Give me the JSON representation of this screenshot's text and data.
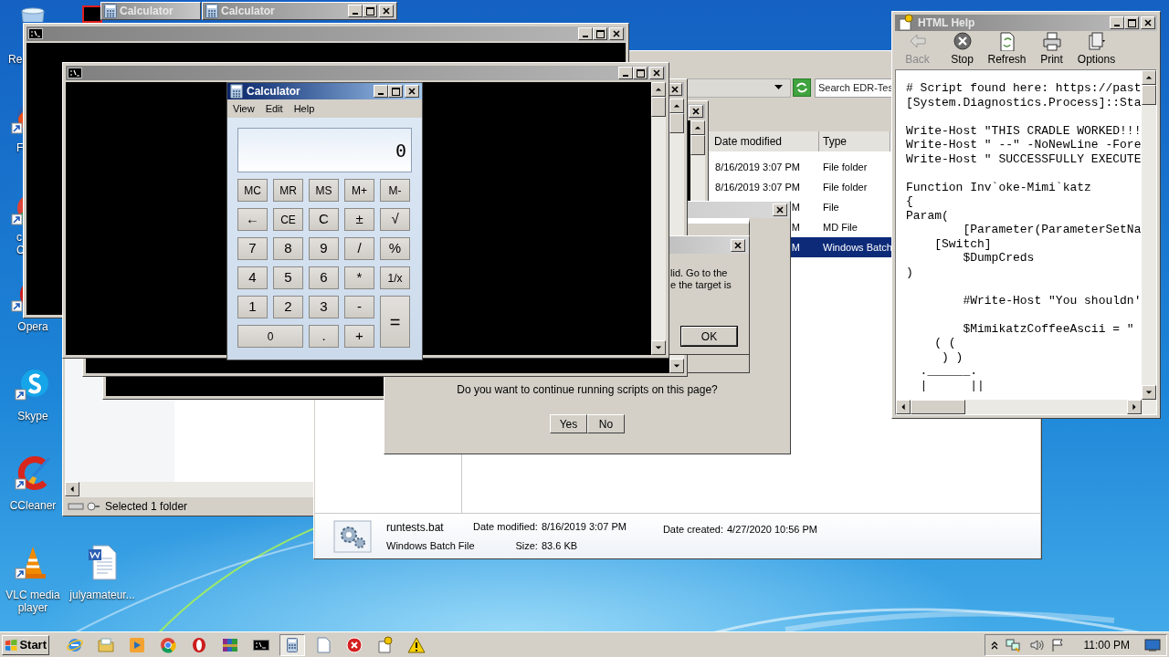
{
  "desktop_icons": [
    {
      "kind": "recycle",
      "label": "Re"
    },
    {
      "kind": "firefox",
      "label": "F"
    },
    {
      "kind": "chrome",
      "label": "c\nC"
    },
    {
      "kind": "opera",
      "label": "Opera"
    },
    {
      "kind": "skype",
      "label": "Skype"
    },
    {
      "kind": "ccleaner",
      "label": "CCleaner"
    },
    {
      "kind": "vlc",
      "label": "VLC media player"
    },
    {
      "kind": "word",
      "label": "julyamateur..."
    }
  ],
  "calculator_titlebars": [
    {
      "title": "Calculator"
    },
    {
      "title": "Calculator"
    }
  ],
  "explorer_back": {
    "status": "Selected 1 folder"
  },
  "explorer": {
    "search_placeholder": "Search EDR-Tes",
    "columns": [
      "Date modified",
      "Type"
    ],
    "rows": [
      {
        "date": "8/16/2019 3:07 PM",
        "type": "File folder",
        "selected": false
      },
      {
        "date": "8/16/2019 3:07 PM",
        "type": "File folder",
        "selected": false
      },
      {
        "date": "M",
        "type": "File",
        "selected": false
      },
      {
        "date": "M",
        "type": "MD File",
        "selected": false
      },
      {
        "date": "M",
        "type": "Windows Batch",
        "selected": true
      }
    ],
    "details": {
      "name": "runtests.bat",
      "file_type": "Windows Batch File",
      "modified_label": "Date modified:",
      "modified": "8/16/2019 3:07 PM",
      "size_label": "Size:",
      "size": "83.6 KB",
      "created_label": "Date created:",
      "created": "4/27/2020 10:56 PM"
    }
  },
  "script_dialog": {
    "message": "Do you want to continue running scripts on this page?",
    "buttons": [
      "Yes",
      "No"
    ]
  },
  "error_dialog": {
    "message": "lid. Go to the\ne the target is",
    "button": "OK"
  },
  "calculator": {
    "title": "Calculator",
    "menu": [
      "View",
      "Edit",
      "Help"
    ],
    "display": "0",
    "keys": [
      {
        "label": "MC",
        "kind": "key"
      },
      {
        "label": "MR",
        "kind": "key"
      },
      {
        "label": "MS",
        "kind": "key"
      },
      {
        "label": "M+",
        "kind": "key"
      },
      {
        "label": "M-",
        "kind": "key"
      },
      {
        "label": "←",
        "kind": "key"
      },
      {
        "label": "CE",
        "kind": "key"
      },
      {
        "label": "C",
        "kind": "key"
      },
      {
        "label": "±",
        "kind": "key"
      },
      {
        "label": "√",
        "kind": "key"
      },
      {
        "label": "7",
        "kind": "key"
      },
      {
        "label": "8",
        "kind": "key"
      },
      {
        "label": "9",
        "kind": "key"
      },
      {
        "label": "/",
        "kind": "key"
      },
      {
        "label": "%",
        "kind": "key"
      },
      {
        "label": "4",
        "kind": "key"
      },
      {
        "label": "5",
        "kind": "key"
      },
      {
        "label": "6",
        "kind": "key"
      },
      {
        "label": "*",
        "kind": "key"
      },
      {
        "label": "1/x",
        "kind": "key"
      },
      {
        "label": "1",
        "kind": "key"
      },
      {
        "label": "2",
        "kind": "key"
      },
      {
        "label": "3",
        "kind": "key"
      },
      {
        "label": "-",
        "kind": "key"
      },
      {
        "label": "=",
        "kind": "tall"
      },
      {
        "label": "0",
        "kind": "wide"
      },
      {
        "label": ".",
        "kind": "key"
      },
      {
        "label": "+",
        "kind": "key"
      }
    ]
  },
  "help_window": {
    "title": "HTML Help",
    "toolbar": [
      {
        "kind": "back",
        "label": "Back",
        "disabled": true
      },
      {
        "kind": "stop",
        "label": "Stop",
        "disabled": false
      },
      {
        "kind": "refresh",
        "label": "Refresh",
        "disabled": false
      },
      {
        "kind": "print",
        "label": "Print",
        "disabled": false
      },
      {
        "kind": "options",
        "label": "Options",
        "disabled": false
      }
    ],
    "code_blocks": [
      [
        "# Script found here: https://past",
        "[System.Diagnostics.Process]::Sta"
      ],
      [
        "Write-Host \"THIS CRADLE WORKED!!!",
        "Write-Host \" --\" -NoNewLine -Fore",
        "Write-Host \" SUCCESSFULLY EXECUTE"
      ],
      [
        "Function Inv`oke-Mimi`katz",
        "{",
        "Param(",
        "        [Parameter(ParameterSetNa",
        "    [Switch]",
        "        $DumpCreds",
        ")"
      ],
      [
        "        #Write-Host \"You shouldn'"
      ],
      [
        "        $MimikatzCoffeeAscii = \"",
        "    ( (",
        "     ) )",
        "  .______.",
        "  |      ||"
      ]
    ]
  },
  "taskbar": {
    "start": "Start",
    "items": [
      {
        "kind": "ie",
        "selected": false
      },
      {
        "kind": "folder",
        "selected": false
      },
      {
        "kind": "media",
        "selected": false
      },
      {
        "kind": "chrome",
        "selected": false
      },
      {
        "kind": "opera",
        "selected": false
      },
      {
        "kind": "archive",
        "selected": false
      },
      {
        "kind": "console",
        "selected": false
      },
      {
        "kind": "calculator",
        "selected": true
      },
      {
        "kind": "document",
        "selected": false
      },
      {
        "kind": "error",
        "selected": false
      },
      {
        "kind": "help",
        "selected": false
      },
      {
        "kind": "warning",
        "selected": false
      }
    ],
    "clock": "11:00 PM"
  }
}
